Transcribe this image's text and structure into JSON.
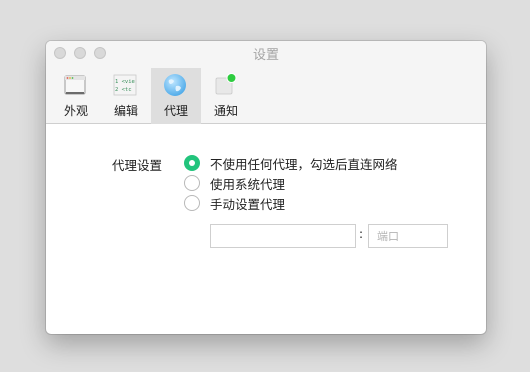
{
  "window": {
    "title": "设置"
  },
  "toolbar": {
    "tabs": [
      {
        "label": "外观",
        "icon": "window-icon"
      },
      {
        "label": "编辑",
        "icon": "code-file-icon",
        "icon_text": [
          "1 <vie",
          "2   <tc"
        ]
      },
      {
        "label": "代理",
        "icon": "globe-icon",
        "active": true
      },
      {
        "label": "通知",
        "icon": "notification-badge-icon"
      }
    ]
  },
  "proxy": {
    "label": "代理设置",
    "options": [
      {
        "label": "不使用任何代理，勾选后直连网络",
        "checked": true
      },
      {
        "label": "使用系统代理",
        "checked": false
      },
      {
        "label": "手动设置代理",
        "checked": false
      }
    ],
    "host": {
      "value": "",
      "placeholder": ""
    },
    "separator": ":",
    "port": {
      "value": "",
      "placeholder": "端口"
    }
  },
  "colors": {
    "accent": "#22c47c",
    "active_tab_bg": "#dedede",
    "badge": "#2ecc40"
  }
}
